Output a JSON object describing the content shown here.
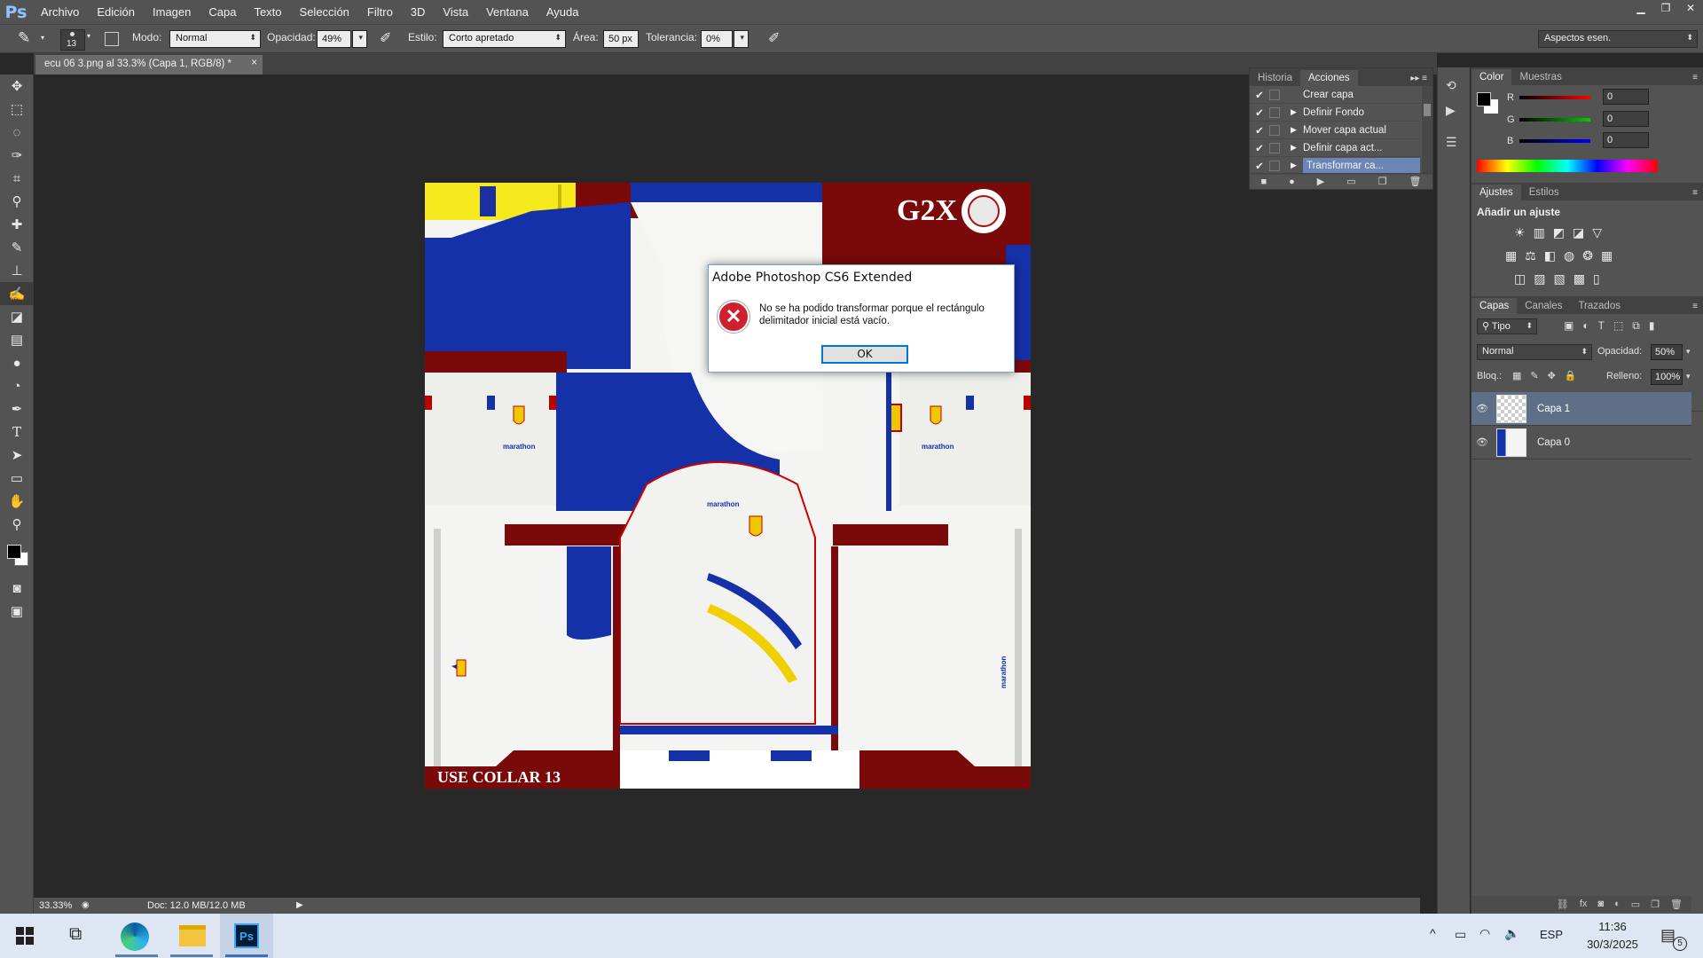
{
  "app": {
    "logo": "Ps",
    "menus": [
      "Archivo",
      "Edición",
      "Imagen",
      "Capa",
      "Texto",
      "Selección",
      "Filtro",
      "3D",
      "Vista",
      "Ventana",
      "Ayuda"
    ],
    "window_controls": {
      "minimize": "▁",
      "restore": "❐",
      "close": "✕"
    }
  },
  "options_bar": {
    "brush_size": "13",
    "mode_label": "Modo:",
    "mode_value": "Normal",
    "opacity_label": "Opacidad:",
    "opacity_value": "49%",
    "style_label": "Estilo:",
    "style_value": "Corto apretado",
    "area_label": "Área:",
    "area_value": "50 px",
    "tolerance_label": "Tolerancia:",
    "tolerance_value": "0%",
    "workspace": "Aspectos esen."
  },
  "document": {
    "tab_title": "ecu 06 3.png al 33.3% (Capa 1, RGB/8) *",
    "tab_close": "×",
    "zoom": "33.33%",
    "doc_info": "Doc: 12.0 MB/12.0 MB"
  },
  "artwork": {
    "brand_text": "G2X",
    "collar_text": "USE COLLAR 13",
    "sponsor": "marathon"
  },
  "actions_panel": {
    "tabs": [
      "Historia",
      "Acciones"
    ],
    "items": [
      {
        "label": "Crear capa",
        "checked": true,
        "selected": false
      },
      {
        "label": "Definir Fondo",
        "checked": true,
        "selected": false
      },
      {
        "label": "Mover capa actual",
        "checked": true,
        "selected": false
      },
      {
        "label": "Definir capa act...",
        "checked": true,
        "selected": false
      },
      {
        "label": "Transformar ca...",
        "checked": true,
        "selected": true
      }
    ]
  },
  "color_panel": {
    "tabs": [
      "Color",
      "Muestras"
    ],
    "r_label": "R",
    "g_label": "G",
    "b_label": "B",
    "r": "0",
    "g": "0",
    "b": "0"
  },
  "adjustments_panel": {
    "tabs": [
      "Ajustes",
      "Estilos"
    ],
    "heading": "Añadir un ajuste"
  },
  "layers_panel": {
    "tabs": [
      "Capas",
      "Canales",
      "Trazados"
    ],
    "filter": "Tipo",
    "blend_mode": "Normal",
    "opacity_label": "Opacidad:",
    "opacity": "50%",
    "lock_label": "Bloq.:",
    "fill_label": "Relleno:",
    "fill": "100%",
    "layers": [
      {
        "name": "Capa 1",
        "selected": true
      },
      {
        "name": "Capa 0",
        "selected": false
      }
    ]
  },
  "dialog": {
    "title": "Adobe Photoshop CS6 Extended",
    "message_line1": "No se ha podido transformar porque el rectángulo",
    "message_line2": "delimitador inicial está vacío.",
    "ok": "OK"
  },
  "taskbar": {
    "language": "ESP",
    "time": "11:36",
    "date": "30/3/2025",
    "notifications": "5"
  }
}
